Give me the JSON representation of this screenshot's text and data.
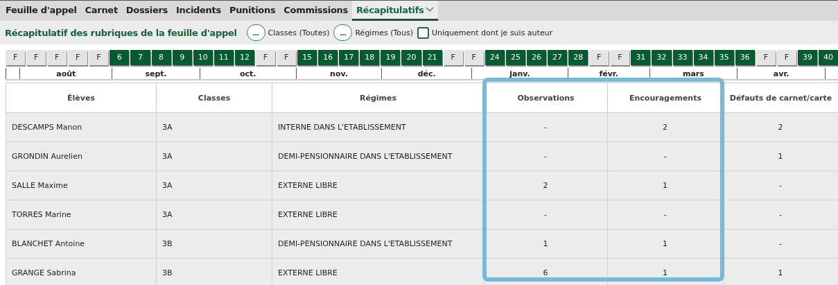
{
  "tabs": [
    {
      "label": "Feuille d'appel",
      "selected": false
    },
    {
      "label": "Carnet",
      "selected": false
    },
    {
      "label": "Dossiers",
      "selected": false
    },
    {
      "label": "Incidents",
      "selected": false
    },
    {
      "label": "Punitions",
      "selected": false
    },
    {
      "label": "Commissions",
      "selected": false
    },
    {
      "label": "Récapitulatifs",
      "selected": true,
      "dropdown": true
    }
  ],
  "toolbar": {
    "title": "Récapitulatif des rubriques de la feuille d'appel",
    "filters": [
      {
        "button": "...",
        "label": "Classes (Toutes)"
      },
      {
        "button": "...",
        "label": "Régimes (Tous)"
      }
    ],
    "checkbox": {
      "label": "Uniquement dont je suis auteur",
      "checked": false
    }
  },
  "weeks": [
    {
      "label": "F",
      "kind": "holiday"
    },
    {
      "label": "F",
      "kind": "holiday"
    },
    {
      "label": "F",
      "kind": "holiday"
    },
    {
      "label": "F",
      "kind": "holiday"
    },
    {
      "label": "F",
      "kind": "holiday"
    },
    {
      "label": "6",
      "kind": "week"
    },
    {
      "label": "7",
      "kind": "week"
    },
    {
      "label": "8",
      "kind": "week"
    },
    {
      "label": "9",
      "kind": "week"
    },
    {
      "label": "10",
      "kind": "week"
    },
    {
      "label": "11",
      "kind": "week"
    },
    {
      "label": "12",
      "kind": "week"
    },
    {
      "label": "F",
      "kind": "holiday"
    },
    {
      "label": "F",
      "kind": "holiday"
    },
    {
      "label": "15",
      "kind": "week"
    },
    {
      "label": "16",
      "kind": "week"
    },
    {
      "label": "17",
      "kind": "week"
    },
    {
      "label": "18",
      "kind": "week"
    },
    {
      "label": "19",
      "kind": "week"
    },
    {
      "label": "20",
      "kind": "week"
    },
    {
      "label": "21",
      "kind": "week"
    },
    {
      "label": "F",
      "kind": "holiday"
    },
    {
      "label": "F",
      "kind": "holiday"
    },
    {
      "label": "24",
      "kind": "week"
    },
    {
      "label": "25",
      "kind": "week"
    },
    {
      "label": "26",
      "kind": "week"
    },
    {
      "label": "27",
      "kind": "week"
    },
    {
      "label": "28",
      "kind": "week"
    },
    {
      "label": "F",
      "kind": "holiday"
    },
    {
      "label": "F",
      "kind": "holiday"
    },
    {
      "label": "31",
      "kind": "week"
    },
    {
      "label": "32",
      "kind": "week"
    },
    {
      "label": "33",
      "kind": "week"
    },
    {
      "label": "34",
      "kind": "week"
    },
    {
      "label": "35",
      "kind": "week"
    },
    {
      "label": "36",
      "kind": "week"
    },
    {
      "label": "F",
      "kind": "holiday"
    },
    {
      "label": "F",
      "kind": "holiday"
    },
    {
      "label": "39",
      "kind": "week"
    },
    {
      "label": "40",
      "kind": "week"
    }
  ],
  "months": [
    "août",
    "sept.",
    "oct.",
    "nov.",
    "déc.",
    "janv.",
    "févr.",
    "mars",
    "avr."
  ],
  "table": {
    "columns": [
      {
        "label": "Élèves",
        "highlighted": false
      },
      {
        "label": "Classes",
        "highlighted": false
      },
      {
        "label": "Régimes",
        "highlighted": false
      },
      {
        "label": "Observations",
        "highlighted": true
      },
      {
        "label": "Encouragements",
        "highlighted": true
      },
      {
        "label": "Défauts de carnet/carte",
        "highlighted": false
      }
    ],
    "rows": [
      [
        "DESCAMPS Manon",
        "3A",
        "INTERNE DANS L'ETABLISSEMENT",
        "-",
        "2",
        "2"
      ],
      [
        "GRONDIN Aurelien",
        "3A",
        "DEMI-PENSIONNAIRE DANS L'ETABLISSEMENT",
        "-",
        "-",
        "1"
      ],
      [
        "SALLE Maxime",
        "3A",
        "EXTERNE LIBRE",
        "2",
        "1",
        "-"
      ],
      [
        "TORRES Marine",
        "3A",
        "EXTERNE LIBRE",
        "-",
        "-",
        "-"
      ],
      [
        "BLANCHET Antoine",
        "3B",
        "DEMI-PENSIONNAIRE DANS L'ETABLISSEMENT",
        "1",
        "1",
        "-"
      ],
      [
        "GRANGE Sabrina",
        "3B",
        "EXTERNE LIBRE",
        "6",
        "1",
        "1"
      ]
    ]
  }
}
